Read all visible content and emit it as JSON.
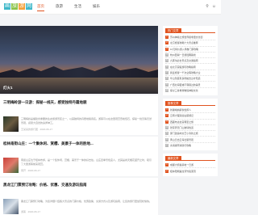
{
  "colors": {
    "accent": "#e0531f",
    "logo": [
      "#3fb8c9",
      "#8bc34a",
      "#f4a13a",
      "#3fb8c9"
    ]
  },
  "header": {
    "logo_chars": [
      "画",
      "旅",
      "游",
      "网"
    ],
    "nav": [
      "首页",
      "旅游",
      "生活",
      "娱乐"
    ],
    "icons": [
      "search-icon",
      "user-icon"
    ]
  },
  "banner": {
    "caption": "灯火1"
  },
  "articles": [
    {
      "title": "三明梅岭游一日游：探秘一线天，感受独特丹霞地貌",
      "desc": "三明梅岭是福建省重要的生态旅游景区之一，以其独特的丹霞地貌闻名。游客可以在这里观赏奇峰怪石，探秘一线天等天然景观，感受大自然的鬼斧神工。",
      "meta": "王某某的旅行团 · 2020-06-17",
      "thumb": "linear-gradient(135deg,#2a3a2a,#6a5a40,#1a1a1a)"
    },
    {
      "title": "桂林南街山庄：一个集休闲、赏樱、美景于一体的胜地...",
      "desc": "南街山庄位于桂林市郊，是一个集休闲、赏樱、美景于一体的好去处。山庄四季景色宜人，尤其是春天樱花盛开之时，吸引了大量游客前来观赏。",
      "meta": "南开 · 2020-06-17",
      "thumb": "linear-gradient(135deg,#c9413a,#e07a6a,#3a6a3a)"
    },
    {
      "title": "黑龙江门票预订攻略：价格、优惠、交通及游玩指南",
      "desc": "黑龙江门票预订攻略，为您详细介绍各大景点的门票价格、优惠政策、交通方式以及游玩指南，让您的旅行更加轻松愉快。",
      "meta": "游客 · 2020-06-17",
      "thumb": "linear-gradient(135deg,#8aa0b8,#d8e0e8,#4a5a70)"
    }
  ],
  "side_panels": [
    {
      "tag": "热门文章",
      "items": [
        "苏州神秘之旅世界级非遗文化街",
        "北京旅游攻略十大景点推荐",
        "10元特价游入场卷门票攻略",
        "杭州西湖一日游经典路线",
        "九寨沟必去景点及交通指南",
        "在北京宫殿游玩攻略指南",
        "我爱旅游一千次全程攻略大全",
        "华山到底有多险峻去过才知道",
        "广西北海银滩不容错过的美景",
        "探寻三星堆博物馆神秘文化"
      ]
    },
    {
      "tag": "推荐文章",
      "items": [
        "新疆喀纳斯秋色醉人",
        "云南大理双廊古镇游记",
        "西藏布达拉宫朝圣之旅",
        "张家界天门山玻璃栈道",
        "厦门鼓浪屿文艺小清新之旅",
        "黄山日出云海壮丽景观",
        "青海湖环湖骑行攻略"
      ]
    },
    {
      "tag": "最新文章",
      "items": [
        "成都大熊猫基地一日游",
        "桂林阳朔遇龙河竹筏漂流"
      ]
    }
  ]
}
